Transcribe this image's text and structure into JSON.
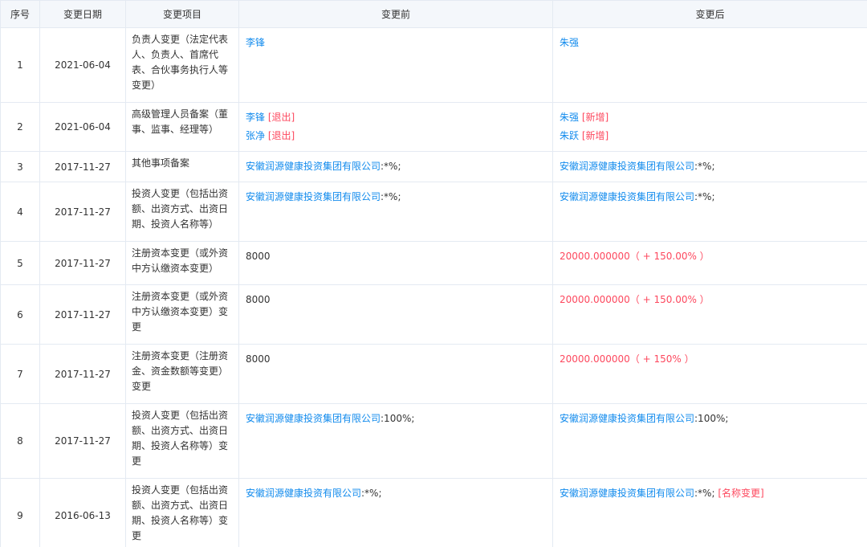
{
  "headers": [
    "序号",
    "变更日期",
    "变更项目",
    "变更前",
    "变更后"
  ],
  "rows": [
    {
      "num": "1",
      "date": "2021-06-04",
      "item": "负责人变更（法定代表人、负责人、首席代表、合伙事务执行人等变更）",
      "before": [
        [
          {
            "t": "李锋",
            "c": "co"
          }
        ]
      ],
      "after": [
        [
          {
            "t": "朱强",
            "c": "co"
          }
        ]
      ]
    },
    {
      "num": "2",
      "date": "2021-06-04",
      "item": "高级管理人员备案（董事、监事、经理等）",
      "before": [
        [
          {
            "t": "李锋",
            "c": "co"
          },
          {
            "t": " [退出]",
            "c": "red"
          }
        ],
        [
          {
            "t": "张净",
            "c": "co"
          },
          {
            "t": " [退出]",
            "c": "red"
          }
        ]
      ],
      "after": [
        [
          {
            "t": "朱强",
            "c": "co"
          },
          {
            "t": " [新增]",
            "c": "red"
          }
        ],
        [
          {
            "t": "朱跃",
            "c": "co"
          },
          {
            "t": " [新增]",
            "c": "red"
          }
        ]
      ]
    },
    {
      "num": "3",
      "date": "2017-11-27",
      "item": "其他事项备案",
      "before": [
        [
          {
            "t": "安徽润源健康投资集团有限公司",
            "c": "co"
          },
          {
            "t": ":*%;",
            "c": ""
          }
        ]
      ],
      "after": [
        [
          {
            "t": "安徽润源健康投资集团有限公司",
            "c": "co"
          },
          {
            "t": ":*%;",
            "c": ""
          }
        ]
      ]
    },
    {
      "num": "4",
      "date": "2017-11-27",
      "item": "投资人变更（包括出资额、出资方式、出资日期、投资人名称等）",
      "before": [
        [
          {
            "t": "安徽润源健康投资集团有限公司",
            "c": "co"
          },
          {
            "t": ":*%;",
            "c": ""
          }
        ]
      ],
      "after": [
        [
          {
            "t": "安徽润源健康投资集团有限公司",
            "c": "co"
          },
          {
            "t": ":*%;",
            "c": ""
          }
        ]
      ]
    },
    {
      "num": "5",
      "date": "2017-11-27",
      "item": "注册资本变更（或外资中方认缴资本变更）",
      "before": [
        [
          {
            "t": "8000",
            "c": ""
          }
        ]
      ],
      "after": [
        [
          {
            "t": "20000.000000（ + 150.00% ）",
            "c": "red"
          }
        ]
      ]
    },
    {
      "num": "6",
      "date": "2017-11-27",
      "item": "注册资本变更（或外资中方认缴资本变更）变更",
      "before": [
        [
          {
            "t": "8000",
            "c": ""
          }
        ]
      ],
      "after": [
        [
          {
            "t": "20000.000000（ + 150.00% ）",
            "c": "red"
          }
        ]
      ]
    },
    {
      "num": "7",
      "date": "2017-11-27",
      "item": "注册资本变更（注册资金、资金数额等变更）变更",
      "before": [
        [
          {
            "t": "8000",
            "c": ""
          }
        ]
      ],
      "after": [
        [
          {
            "t": "20000.000000（ + 150% ）",
            "c": "red"
          }
        ]
      ]
    },
    {
      "num": "8",
      "date": "2017-11-27",
      "item": "投资人变更（包括出资额、出资方式、出资日期、投资人名称等）变更",
      "before": [
        [
          {
            "t": "安徽润源健康投资集团有限公司",
            "c": "co"
          },
          {
            "t": ":100%;",
            "c": ""
          }
        ]
      ],
      "after": [
        [
          {
            "t": "安徽润源健康投资集团有限公司",
            "c": "co"
          },
          {
            "t": ":100%;",
            "c": ""
          }
        ]
      ]
    },
    {
      "num": "9",
      "date": "2016-06-13",
      "item": "投资人变更（包括出资额、出资方式、出资日期、投资人名称等）变更",
      "before": [
        [
          {
            "t": "安徽润源健康投资有限公司",
            "c": "co"
          },
          {
            "t": ":*%;",
            "c": ""
          }
        ]
      ],
      "after": [
        [
          {
            "t": "安徽润源健康投资集团有限公司",
            "c": "co"
          },
          {
            "t": ":*%; ",
            "c": ""
          },
          {
            "t": "[名称变更]",
            "c": "red"
          }
        ]
      ]
    }
  ]
}
